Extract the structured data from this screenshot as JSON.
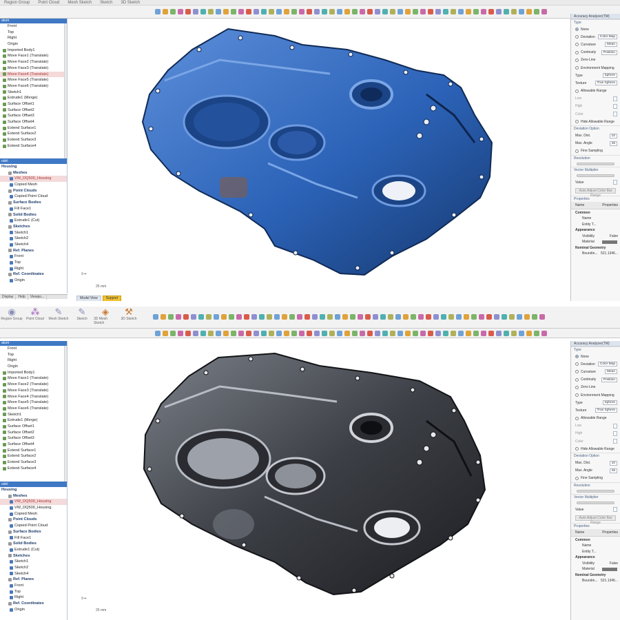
{
  "top": {
    "ribbon_tabs": [
      "Region Group",
      "Point Cloud",
      "Mesh Sketch",
      "Sketch",
      "3D Sketch"
    ],
    "tree": {
      "items": [
        {
          "label": "Front",
          "icon": "none"
        },
        {
          "label": "Top",
          "icon": "none"
        },
        {
          "label": "Right",
          "icon": "none"
        },
        {
          "label": "Origin",
          "icon": "none"
        },
        {
          "label": "Imported Body1",
          "icon": "green"
        },
        {
          "label": "Move Face1 (Translate)",
          "icon": "green"
        },
        {
          "label": "Move Face2 (Translate)",
          "icon": "green"
        },
        {
          "label": "Move Face3 (Translate)",
          "icon": "green"
        },
        {
          "label": "Move Face4 (Translate)",
          "icon": "green",
          "selected": true
        },
        {
          "label": "Move Face5 (Translate)",
          "icon": "green"
        },
        {
          "label": "Move Face6 (Translate)",
          "icon": "green"
        },
        {
          "label": "Sketch1",
          "icon": "green"
        },
        {
          "label": "Extrude1 (Merge)",
          "icon": "green"
        },
        {
          "label": "Surface Offset1",
          "icon": "green"
        },
        {
          "label": "Surface Offset2",
          "icon": "green"
        },
        {
          "label": "Surface Offset3",
          "icon": "green"
        },
        {
          "label": "Surface Offset4",
          "icon": "green"
        },
        {
          "label": "Extend Surface1",
          "icon": "green"
        },
        {
          "label": "Extend Surface2",
          "icon": "green"
        },
        {
          "label": "Extend Surface3",
          "icon": "green"
        },
        {
          "label": "Extend Surface4",
          "icon": "green"
        }
      ]
    },
    "model": {
      "header": "Housing",
      "rows": [
        {
          "label": "Meshes",
          "type": "cat"
        },
        {
          "label": "VW_DQ500_Housing",
          "type": "item",
          "selected": true
        },
        {
          "label": "Copied Mesh",
          "type": "item"
        },
        {
          "label": "Point Clouds",
          "type": "cat"
        },
        {
          "label": "Copied Point Cloud",
          "type": "item"
        },
        {
          "label": "Surface Bodies",
          "type": "cat"
        },
        {
          "label": "Fill Face1",
          "type": "item"
        },
        {
          "label": "Solid Bodies",
          "type": "cat"
        },
        {
          "label": "Extrude1 (Cut)",
          "type": "item"
        },
        {
          "label": "Sketches",
          "type": "cat"
        },
        {
          "label": "Sketch1",
          "type": "item"
        },
        {
          "label": "Sketch2",
          "type": "item"
        },
        {
          "label": "Sketch4",
          "type": "item"
        },
        {
          "label": "Ref. Planes",
          "type": "cat"
        },
        {
          "label": "Front",
          "type": "item"
        },
        {
          "label": "Top",
          "type": "item"
        },
        {
          "label": "Right",
          "type": "item"
        },
        {
          "label": "Ref. Coordinates",
          "type": "cat"
        },
        {
          "label": "Origin",
          "type": "item"
        }
      ]
    },
    "status_tabs": [
      "Display",
      "Help",
      "Viewpo..."
    ],
    "viewport_tabs": [
      "Model View",
      "Support"
    ],
    "scale": "25 mm",
    "part_color": "#2c63b8"
  },
  "bottom": {
    "big_tools": [
      {
        "label": "Region Group",
        "icon": "region-group-icon"
      },
      {
        "label": "Point Cloud",
        "icon": "point-cloud-icon"
      },
      {
        "label": "Mesh Sketch",
        "icon": "mesh-sketch-icon"
      },
      {
        "label": "Sketch",
        "icon": "sketch-icon"
      },
      {
        "label": "3D Mesh Sketch",
        "icon": "3d-mesh-sketch-icon"
      },
      {
        "label": "3D Sketch",
        "icon": "3d-sketch-icon"
      }
    ],
    "tree": {
      "items": [
        {
          "label": "Front",
          "icon": "none"
        },
        {
          "label": "Top",
          "icon": "none"
        },
        {
          "label": "Right",
          "icon": "none"
        },
        {
          "label": "Origin",
          "icon": "none"
        },
        {
          "label": "Imported Body1",
          "icon": "green"
        },
        {
          "label": "Move Face1 (Translate)",
          "icon": "green"
        },
        {
          "label": "Move Face2 (Translate)",
          "icon": "green"
        },
        {
          "label": "Move Face3 (Translate)",
          "icon": "green"
        },
        {
          "label": "Move Face4 (Translate)",
          "icon": "green"
        },
        {
          "label": "Move Face5 (Translate)",
          "icon": "green"
        },
        {
          "label": "Move Face6 (Translate)",
          "icon": "green"
        },
        {
          "label": "Sketch1",
          "icon": "green"
        },
        {
          "label": "Extrude1 (Merge)",
          "icon": "green"
        },
        {
          "label": "Surface Offset1",
          "icon": "green"
        },
        {
          "label": "Surface Offset2",
          "icon": "green"
        },
        {
          "label": "Surface Offset3",
          "icon": "green"
        },
        {
          "label": "Surface Offset4",
          "icon": "green"
        },
        {
          "label": "Extend Surface1",
          "icon": "green"
        },
        {
          "label": "Extend Surface2",
          "icon": "green"
        },
        {
          "label": "Extend Surface3",
          "icon": "green"
        },
        {
          "label": "Extend Surface4",
          "icon": "green"
        }
      ]
    },
    "model": {
      "header": "Housing",
      "rows": [
        {
          "label": "Meshes",
          "type": "cat"
        },
        {
          "label": "VW_DQ500_Housing",
          "type": "item",
          "selected": true
        },
        {
          "label": "VW_DQ500_Housing",
          "type": "item"
        },
        {
          "label": "Copied Mesh",
          "type": "item"
        },
        {
          "label": "Point Clouds",
          "type": "cat"
        },
        {
          "label": "Copied Point Cloud",
          "type": "item"
        },
        {
          "label": "Surface Bodies",
          "type": "cat"
        },
        {
          "label": "Fill Face1",
          "type": "item"
        },
        {
          "label": "Solid Bodies",
          "type": "cat"
        },
        {
          "label": "Extrude1 (Cut)",
          "type": "item"
        },
        {
          "label": "Sketches",
          "type": "cat"
        },
        {
          "label": "Sketch1",
          "type": "item"
        },
        {
          "label": "Sketch2",
          "type": "item"
        },
        {
          "label": "Sketch4",
          "type": "item"
        },
        {
          "label": "Ref. Planes",
          "type": "cat"
        },
        {
          "label": "Front",
          "type": "item"
        },
        {
          "label": "Top",
          "type": "item"
        },
        {
          "label": "Right",
          "type": "item"
        },
        {
          "label": "Ref. Coordinates",
          "type": "cat"
        },
        {
          "label": "Origin",
          "type": "item"
        }
      ]
    },
    "scale": "25 mm",
    "part_color": "#3c3f45"
  },
  "panel": {
    "title": "Accuracy Analyzer(TM)",
    "type_label": "Type",
    "options": [
      {
        "label": "None",
        "on": true
      },
      {
        "label": "Deviation",
        "field": "Color Map"
      },
      {
        "label": "Curvature",
        "field": "Mean"
      },
      {
        "label": "Continuity",
        "field": "Position"
      },
      {
        "label": "Zero-Line"
      },
      {
        "label": "Environment Mapping"
      }
    ],
    "env": [
      {
        "label": "Type",
        "field": "Sphere"
      },
      {
        "label": "Texture",
        "field": "True Sphere"
      }
    ],
    "allowable_range": "Allowable Range",
    "low": "Low",
    "high": "High",
    "color": "Color",
    "hide_allowable": "Hide Allowable Range",
    "deviation_option": "Deviation Option",
    "max_dist": "Max. Dist.",
    "max_dist_val": "10",
    "max_angle": "Max. Angle",
    "max_angle_val": "45",
    "fine_sampling": "Fine Sampling",
    "resolution": "Resolution",
    "vector_multiplier": "Vector Multiplier",
    "value": "Value",
    "adjust_button": "Auto Adjust Color Bar Range",
    "properties": "Properties",
    "prop_col_name": "Name",
    "prop_col_prop": "Properties",
    "common": "Common",
    "name": "Name",
    "entity": "Entity T...",
    "appearance": "Appearance",
    "visibility": "Visibility",
    "visibility_val": "False",
    "material": "Material",
    "nominal": "Nominal Geometry",
    "bounding": "Boundin...",
    "bounding_val": "521.1346..."
  }
}
